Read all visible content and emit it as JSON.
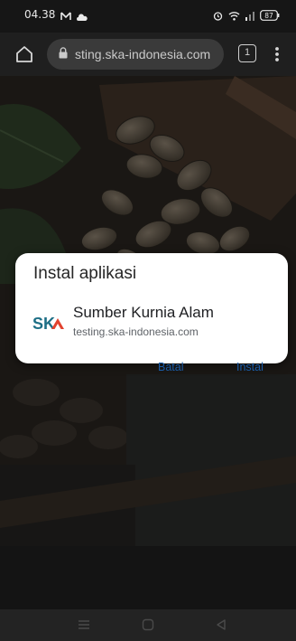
{
  "status_bar": {
    "time": "04.38",
    "left_icons": [
      "gmail-icon",
      "cloud-icon"
    ],
    "right_icons": [
      "alarm-icon",
      "wifi-icon",
      "signal-icon",
      "battery-icon"
    ],
    "battery_level": "87"
  },
  "browser": {
    "url_text": "sting.ska-indonesia.com",
    "tab_count": "1",
    "icons": {
      "home": "home-icon",
      "lock": "lock-icon",
      "menu": "more-vert-icon"
    }
  },
  "dialog": {
    "title": "Instal aplikasi",
    "app_name": "Sumber Kurnia Alam",
    "app_url": "testing.ska-indonesia.com",
    "logo_text": "SK",
    "cancel_label": "Batal",
    "install_label": "Instal",
    "accent_color": "#1a5ca8",
    "logo_colors": {
      "text": "#1e6f86",
      "triangle": "#e2432f"
    }
  },
  "nav": {
    "icons": [
      "menu-lines-icon",
      "home-square-icon",
      "back-triangle-icon"
    ]
  }
}
